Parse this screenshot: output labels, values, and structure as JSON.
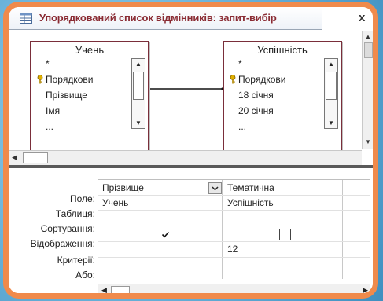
{
  "window": {
    "title": "Упорядкований список відмінників: запит-вибір",
    "close_glyph": "x",
    "frame_color": "#f08a4b",
    "title_color": "#8a2b33"
  },
  "tables": [
    {
      "name": "Учень",
      "fields": [
        "*",
        "Порядкови",
        "Прізвище",
        "Імя",
        "..."
      ],
      "key_field_index": 1
    },
    {
      "name": "Успішність",
      "fields": [
        "*",
        "Порядкови",
        "18 січня",
        "20 січня",
        "..."
      ],
      "key_field_index": 1
    }
  ],
  "grid": {
    "row_labels": [
      "Поле:",
      "Таблиця:",
      "Сортування:",
      "Відображення:",
      "Критерії:",
      "Або:"
    ],
    "columns": [
      {
        "field": "Прізвище",
        "table": "Учень",
        "sort": "",
        "show": true,
        "criteria": "",
        "or": ""
      },
      {
        "field": "Тематична",
        "table": "Успішність",
        "sort": "",
        "show": false,
        "criteria": "12",
        "or": ""
      }
    ]
  },
  "icons": {
    "window": "query-design-icon",
    "key": "key-icon",
    "scroll_up": "scroll-up-arrow-icon",
    "scroll_down": "scroll-down-arrow-icon",
    "scroll_left": "scroll-left-arrow-icon",
    "scroll_right": "scroll-right-arrow-icon",
    "dropdown": "dropdown-arrow-icon",
    "checkbox_checked": "checkbox-checked-icon"
  }
}
